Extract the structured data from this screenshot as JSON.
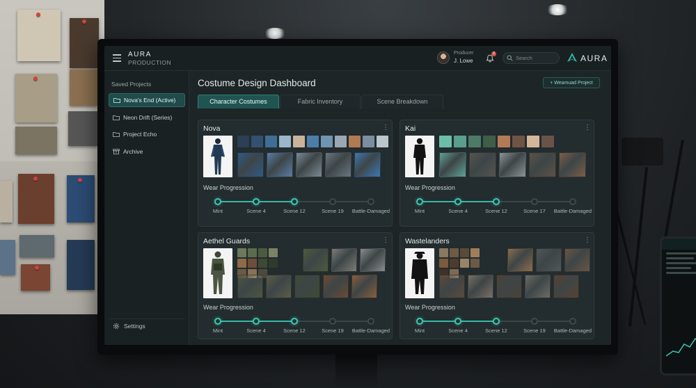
{
  "app": {
    "brand_line1": "AURA",
    "brand_line2": "PRODUCTION",
    "logo_text": "AURA"
  },
  "header": {
    "producer_role": "Producer",
    "producer_name": "J. Lowe",
    "search_placeholder": "Search",
    "notification_count": "2"
  },
  "sidebar": {
    "title": "Saved Projects",
    "items": [
      {
        "label": "Nova's End (Active)",
        "icon": "folder-icon",
        "active": true
      },
      {
        "label": "Neon Drift (Series)",
        "icon": "folder-icon",
        "active": false
      },
      {
        "label": "Project Echo",
        "icon": "folder-icon",
        "active": false
      },
      {
        "label": "Archive",
        "icon": "archive-icon",
        "active": false
      }
    ],
    "settings_label": "Settings"
  },
  "main": {
    "title": "Costume Design Dashboard",
    "new_button": "+ Weamuad Project",
    "tabs": [
      {
        "label": "Character Costumes",
        "active": true
      },
      {
        "label": "Fabric Inventory",
        "active": false
      },
      {
        "label": "Scene Breakdown",
        "active": false
      }
    ],
    "cards": [
      {
        "name": "Nova",
        "wear_title": "Wear Progression",
        "progress_fraction": 0.5,
        "stages": [
          "Mint",
          "Scene 4",
          "Scene 12",
          "Scene 19",
          "Battle-Damaged"
        ],
        "stages_done": 3,
        "palette": [
          "#2b3f55",
          "#34506f",
          "#3f6f96",
          "#9ab7c9",
          "#c9b39a",
          "#4b7ea9",
          "#6f95b3",
          "#99a8b3",
          "#b07a52",
          "#7c8da0",
          "#b9c6cc"
        ],
        "textures": [
          "#2f5a88",
          "#5a7ea6",
          "#7d8a95",
          "#6a7682",
          "#3e78b5"
        ]
      },
      {
        "name": "Kai",
        "wear_title": "Wear Progression",
        "progress_fraction": 0.5,
        "stages": [
          "Mint",
          "Scene 4",
          "Scene 12",
          "Scene 17",
          "Battle-Damaged"
        ],
        "stages_done": 3,
        "palette": [
          "#6bbfa9",
          "#5a9e8c",
          "#4c7a66",
          "#3f5e48",
          "#b37a56",
          "#6f5446",
          "#d4b79a",
          "#6b5248"
        ],
        "textures": [
          "#5ea396",
          "#555651",
          "#8d9497",
          "#5d5248",
          "#7b5e4a"
        ]
      },
      {
        "name": "Aethel Guards",
        "wear_title": "Wear Progression",
        "progress_fraction": 0.5,
        "stages": [
          "Mint",
          "Scene 4",
          "Scene 12",
          "Scene 19",
          "Battle-Damaged"
        ],
        "stages_done": 3,
        "palette": [
          "#6d7a5a",
          "#5b6b4d",
          "#4c5a40",
          "#7a8363",
          "#8f6a48",
          "#6d4e3a",
          "#3c4a36",
          "#2f3a2b",
          "#6b5a45",
          "#8a7156",
          "#4e4a3a"
        ],
        "textures": [
          "#4f5a3c",
          "#7e7d78",
          "#8a8d8f",
          "#4d5642",
          "#5b5d4a",
          "#3f4a35",
          "#6d4a35",
          "#8a5e3c"
        ]
      },
      {
        "name": "Wastelanders",
        "wear_title": "Wear Progression",
        "progress_fraction": 0.5,
        "stages": [
          "Mint",
          "Scene 4",
          "Scene 12",
          "Scene 19",
          "Battle-Damaged"
        ],
        "stages_done": 3,
        "palette": [
          "#8a7860",
          "#6f5a44",
          "#5a4a3a",
          "#a07e5a",
          "#7b5a3d",
          "#4d3b2e",
          "#9a8466",
          "#6a5a48",
          "#3f3228",
          "#7e6a52"
        ],
        "textures": [
          "#8c6e4c",
          "#52565a",
          "#6a5644",
          "#5c4a3a",
          "#7b7064",
          "#4e4237",
          "#6d6e66",
          "#5a4130"
        ]
      }
    ]
  }
}
